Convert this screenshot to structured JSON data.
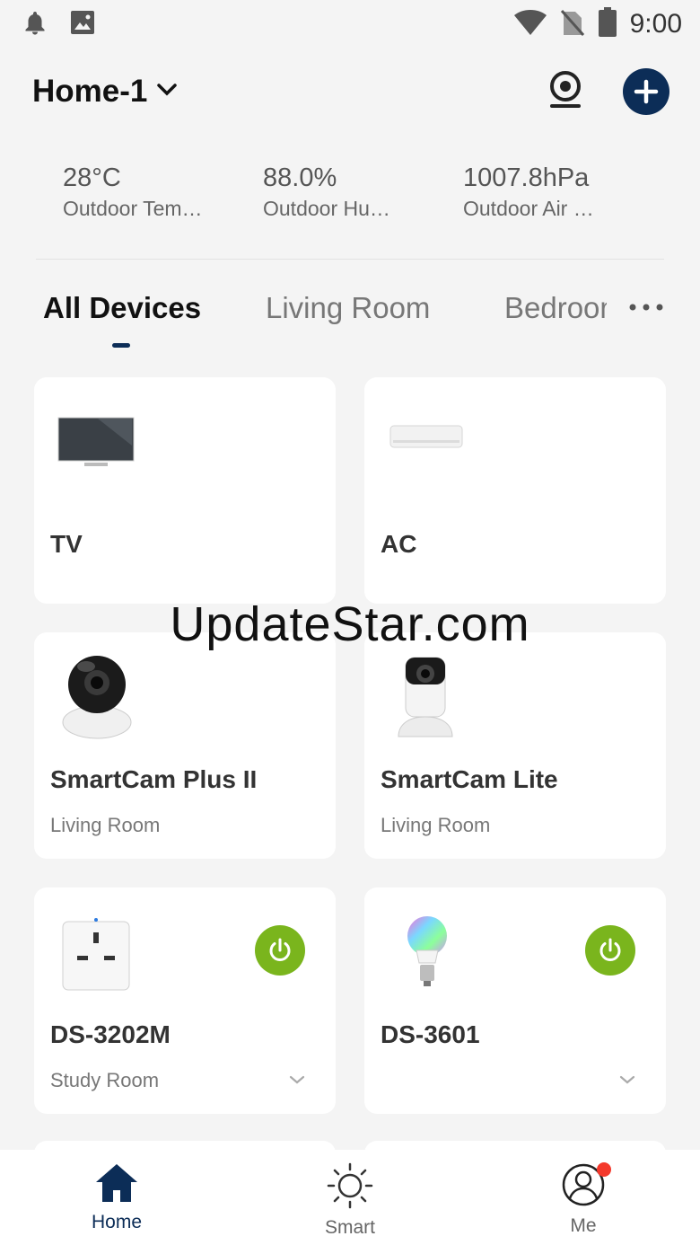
{
  "status_bar": {
    "time": "9:00",
    "left_icons": [
      "bell-icon",
      "image-icon"
    ],
    "right_icons": [
      "wifi-icon",
      "no-sim-icon",
      "battery-icon"
    ]
  },
  "header": {
    "home_name": "Home-1",
    "actions": [
      "camera-icon",
      "add-icon"
    ],
    "accent_color": "#0c2d57"
  },
  "weather": [
    {
      "value": "28°C",
      "label": "Outdoor Temperature"
    },
    {
      "value": "88.0%",
      "label": "Outdoor Humidity"
    },
    {
      "value": "1007.8hPa",
      "label": "Outdoor Air Pressure"
    }
  ],
  "tabs": [
    {
      "label": "All Devices",
      "active": true
    },
    {
      "label": "Living Room",
      "active": false
    },
    {
      "label": "Bedroom",
      "active": false
    }
  ],
  "devices": [
    {
      "name": "TV",
      "room": "",
      "image": "tv-image"
    },
    {
      "name": "AC",
      "room": "",
      "image": "ac-image"
    },
    {
      "name": "SmartCam Plus II",
      "room": "Living Room",
      "image": "pan-tilt-camera-image"
    },
    {
      "name": "SmartCam Lite",
      "room": "Living Room",
      "image": "mini-camera-image"
    },
    {
      "name": "DS-3202M",
      "room": "Study Room",
      "image": "smart-plug-image",
      "power": "on"
    },
    {
      "name": "DS-3601",
      "room": "",
      "image": "smart-bulb-image",
      "power": "on"
    }
  ],
  "power_color": "#7ab51d",
  "watermark": "UpdateStar.com",
  "bottom_nav": [
    {
      "label": "Home",
      "icon": "home-icon",
      "active": true
    },
    {
      "label": "Smart",
      "icon": "sun-icon",
      "active": false
    },
    {
      "label": "Me",
      "icon": "user-icon",
      "active": false,
      "badge": true
    }
  ]
}
